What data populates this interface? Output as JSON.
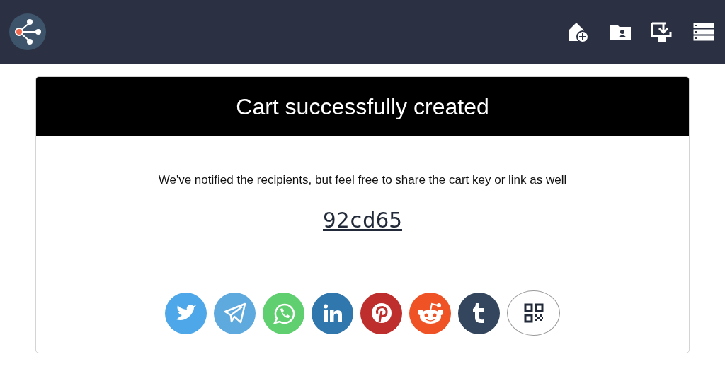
{
  "card": {
    "title": "Cart successfully created",
    "message": "We've notified the recipients, but feel free to share the cart key or link as well",
    "cart_key": "92cd65"
  },
  "share_buttons": [
    {
      "color": "#4da7e8"
    },
    {
      "color": "#5ea9dd"
    },
    {
      "color": "#5fcf6f"
    },
    {
      "color": "#2f77ad"
    },
    {
      "color": "#bd2e2c"
    },
    {
      "color": "#ef5325"
    },
    {
      "color": "#34465d"
    },
    {
      "color": "#ffffff"
    }
  ]
}
